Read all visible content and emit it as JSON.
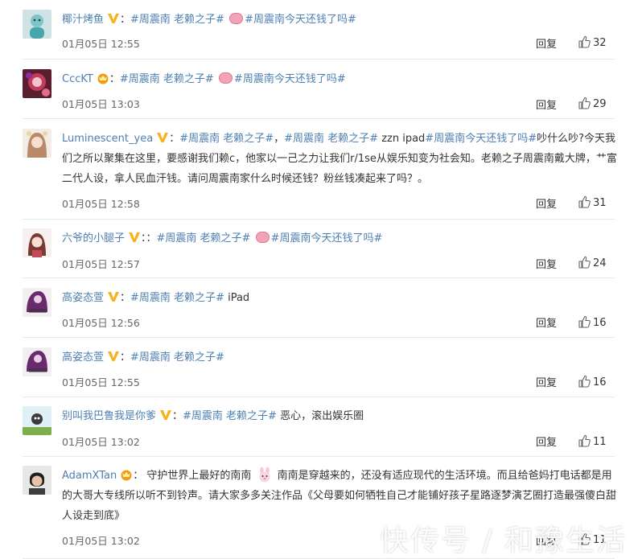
{
  "comments": [
    {
      "username": "椰汁烤鱼",
      "badge": "v-badge",
      "sep": "：",
      "tag1": "#周震南 老赖之子#",
      "tag2": "#周震南今天还钱了吗#",
      "time": "01月05日 12:55",
      "reply": "回复",
      "likes": "32"
    },
    {
      "username": "CccKT",
      "badge": "crown-badge",
      "sep": "：",
      "tag1": "#周震南 老赖之子#",
      "tag2": "#周震南今天还钱了吗#",
      "time": "01月05日 13:03",
      "reply": "回复",
      "likes": "29"
    },
    {
      "username": "Luminescent_yea",
      "badge": "v-badge",
      "sep": "：",
      "tag1": "#周震南 老赖之子#",
      "sep2": "，",
      "tag2": "#周震南 老赖之子#",
      "mid": " zzn ipad",
      "tag3": "#周震南今天还钱了吗#",
      "body": "吵什么吵?今天我们之所以聚集在这里，要感谢我们赖c，他家以一己之力让我们r/1se从娱乐知变为社会知。老赖之子周震南戴大牌，艹富二代人设，拿人民血汗钱。请问周震南家什么时候还钱？粉丝钱凑起来了吗？。",
      "time": "01月05日 12:58",
      "reply": "回复",
      "likes": "31"
    },
    {
      "username": "六爷的小腿子",
      "badge": "v-badge",
      "sep": "：：",
      "tag1": "#周震南 老赖之子#",
      "tag2": "#周震南今天还钱了吗#",
      "time": "01月05日 12:57",
      "reply": "回复",
      "likes": "24"
    },
    {
      "username": "高姿态萱",
      "badge": "v-badge",
      "sep": "：",
      "tag1": "#周震南 老赖之子#",
      "body": " iPad",
      "time": "01月05日 12:56",
      "reply": "回复",
      "likes": "16"
    },
    {
      "username": "高姿态萱",
      "badge": "v-badge",
      "sep": "：",
      "tag1": "#周震南 老赖之子#",
      "time": "01月05日 12:55",
      "reply": "回复",
      "likes": "16"
    },
    {
      "username": "别叫我巴鲁我是你爹",
      "badge": "v-badge",
      "sep": "：",
      "tag1": "#周震南 老赖之子#",
      "body": " 恶心，滚出娱乐圈",
      "time": "01月05日 13:02",
      "reply": "回复",
      "likes": "11"
    },
    {
      "username": "AdamXTan",
      "badge": "crown-badge",
      "sep": "：",
      "body1": " 守护世界上最好的南南",
      "body2": " 南南是穿越来的，还没有适应现代的生活环境。而且给爸妈打电话都是用的大哥大专线所以听不到铃声。请大家多多关注作品《父母要如何牺牲自己才能铺好孩子星路逐梦演艺圈打造最强傻白甜人设走到底》",
      "time": "01月05日 13:02",
      "reply": "回复",
      "likes": "11"
    }
  ],
  "watermark": "快传号 / 和豫生活",
  "colors": {
    "link": "#4d7fb2",
    "badge_v": "#f7b21c",
    "badge_crown": "#f29b14"
  }
}
